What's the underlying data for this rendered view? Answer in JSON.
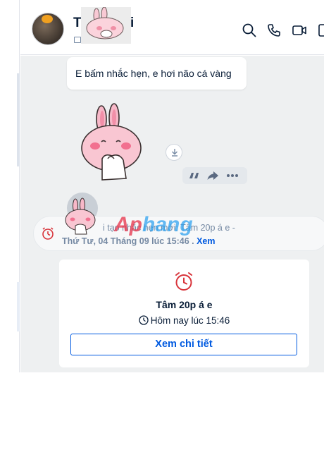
{
  "header": {
    "contact_name_start": "T",
    "contact_name_end": "i",
    "icons": [
      "search-icon",
      "phone-icon",
      "video-call-icon",
      "sidebar-toggle-icon"
    ]
  },
  "messages": {
    "text_bubble": "E bấm nhắc hẹn, e hơi não cá vàng",
    "actions": [
      "quote-icon",
      "forward-icon",
      "more-icon"
    ]
  },
  "reminder_notice": {
    "line1": "i tạo nhắc hẹn mới: Tâm 20p á e -",
    "line2_date": "Thứ Tư, 04 Tháng 09 lúc 15:46 .",
    "line2_link": "Xem"
  },
  "watermark": {
    "part_a": "Ap",
    "part_b": "hang"
  },
  "reminder_card": {
    "title": "Tâm 20p á e",
    "time": "Hôm nay lúc 15:46",
    "button_label": "Xem chi tiết"
  },
  "colors": {
    "accent": "#005ae0",
    "alarm": "#d8343b",
    "chat_bg": "#eef0f1",
    "muted_text": "#7589a3"
  }
}
